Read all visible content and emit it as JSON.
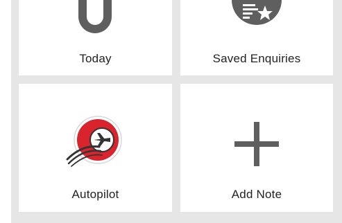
{
  "tiles": {
    "today": {
      "label": "Today",
      "icon": "calendar-day-icon"
    },
    "saved": {
      "label": "Saved Enquiries",
      "icon": "saved-enquiries-icon"
    },
    "auto": {
      "label": "Autopilot",
      "icon": "autopilot-logo-icon"
    },
    "note": {
      "label": "Add Note",
      "icon": "plus-icon"
    }
  },
  "colors": {
    "background": "#e6e6e6",
    "tile": "#ffffff",
    "icon_gray": "#5f5f5f",
    "brand_red": "#d9232d",
    "text": "#222222"
  }
}
